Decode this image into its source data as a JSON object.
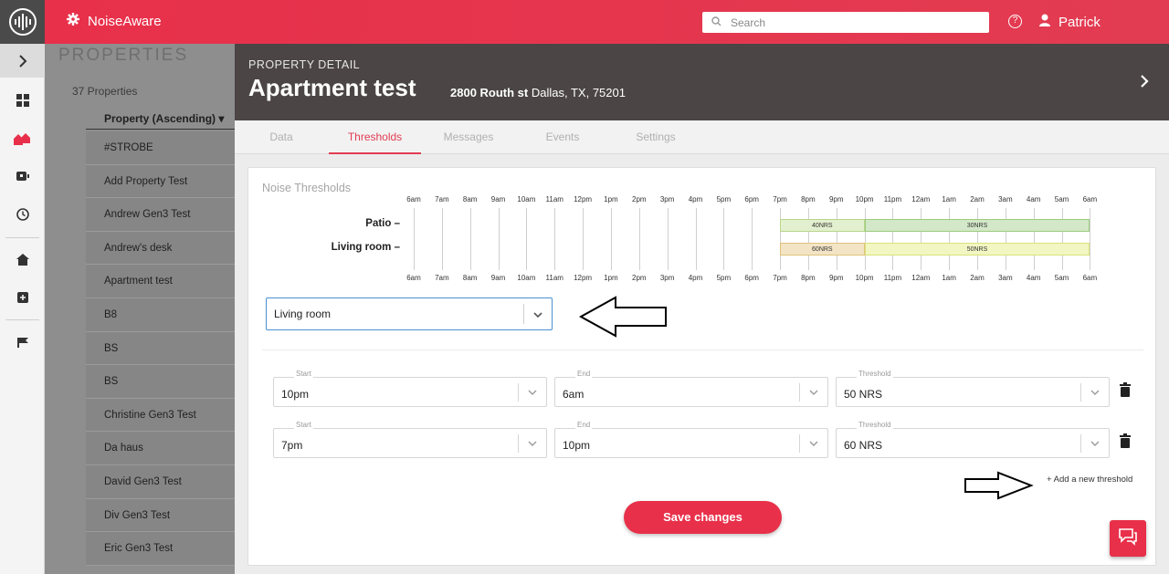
{
  "app": {
    "name": "NoiseAware"
  },
  "topbar": {
    "search_placeholder": "Search",
    "help_label": "?",
    "user_name": "Patrick"
  },
  "properties_list": {
    "heading": "PROPERTIES",
    "count_label": "37 Properties",
    "column_header": "Property (Ascending) ▾",
    "items": [
      "#STROBE",
      "Add Property Test",
      "Andrew Gen3 Test",
      "Andrew's desk",
      "Apartment test",
      "B8",
      "BS",
      "BS",
      "Christine Gen3 Test",
      "Da haus",
      "David Gen3 Test",
      "Div Gen3 Test",
      "Eric Gen3 Test"
    ]
  },
  "detail": {
    "kicker": "PROPERTY DETAIL",
    "title": "Apartment test",
    "address_street": "2800 Routh st",
    "address_city": "Dallas, TX, 75201"
  },
  "tabs": [
    "Data",
    "Thresholds",
    "Messages",
    "Events",
    "Settings"
  ],
  "active_tab": "Thresholds",
  "noise_thresholds": {
    "title": "Noise Thresholds",
    "hours": [
      "6am",
      "7am",
      "8am",
      "9am",
      "10am",
      "11am",
      "12pm",
      "1pm",
      "2pm",
      "3pm",
      "4pm",
      "5pm",
      "6pm",
      "7pm",
      "8pm",
      "9pm",
      "10pm",
      "11pm",
      "12am",
      "1am",
      "2am",
      "3am",
      "4am",
      "5am",
      "6am"
    ],
    "rooms": [
      {
        "label": "Patio –",
        "segments": [
          {
            "text": "40NRS",
            "color": "#e3f0cf",
            "border": "#b8d68a"
          },
          {
            "text": "30NRS",
            "color": "#d3e8c8",
            "border": "#9ccc7e"
          }
        ]
      },
      {
        "label": "Living room –",
        "segments": [
          {
            "text": "60NRS",
            "color": "#f3e4c5",
            "border": "#e0c27a"
          },
          {
            "text": "50NRS",
            "color": "#f2f6c2",
            "border": "#d9e27a"
          }
        ]
      }
    ]
  },
  "room_select": {
    "value": "Living room"
  },
  "thresholds": [
    {
      "start_label": "Start",
      "start": "10pm",
      "end_label": "End",
      "end": "6am",
      "threshold_label": "Threshold",
      "threshold": "50 NRS"
    },
    {
      "start_label": "Start",
      "start": "7pm",
      "end_label": "End",
      "end": "10pm",
      "threshold_label": "Threshold",
      "threshold": "60 NRS"
    }
  ],
  "add_threshold_label": "+ Add a new threshold",
  "save_label": "Save changes",
  "colors": {
    "brand": "#e8304a",
    "header_dark": "#4b4545",
    "focus_blue": "#4a8fd4"
  }
}
